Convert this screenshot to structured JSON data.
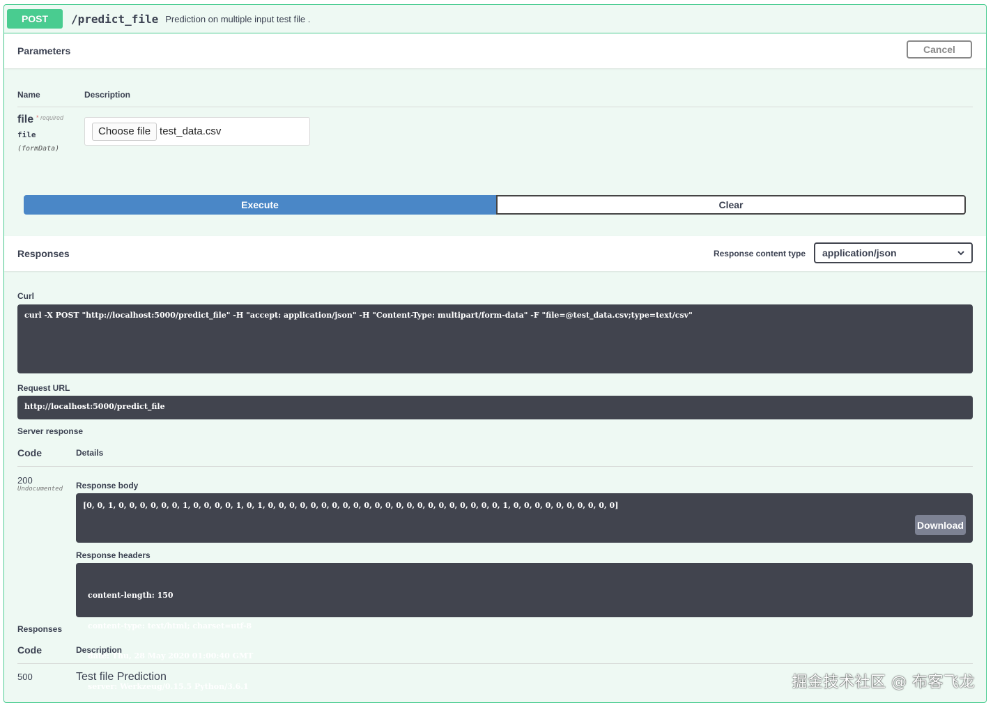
{
  "operation": {
    "method": "POST",
    "path": "/predict_file",
    "summary": "Prediction on multiple input test file ."
  },
  "parameters": {
    "title": "Parameters",
    "cancel_label": "Cancel",
    "col_name": "Name",
    "col_description": "Description",
    "param": {
      "name": "file",
      "required_marker": "*",
      "required_label": "required",
      "type": "file",
      "in": "(formData)",
      "choose_label": "Choose file",
      "file_value": "test_data.csv"
    },
    "execute_label": "Execute",
    "clear_label": "Clear"
  },
  "responses_header": {
    "title": "Responses",
    "content_type_label": "Response content type",
    "content_type_value": "application/json"
  },
  "live": {
    "curl_label": "Curl",
    "curl": "curl -X POST \"http://localhost:5000/predict_file\" -H \"accept: application/json\" -H \"Content-Type: multipart/form-data\" -F \"file=@test_data.csv;type=text/csv\"",
    "request_url_label": "Request URL",
    "request_url": "http://localhost:5000/predict_file",
    "server_response_label": "Server response",
    "code_header": "Code",
    "details_header": "Details",
    "code": "200",
    "code_note": "Undocumented",
    "body_label": "Response body",
    "body": "[0, 0, 1, 0, 0, 0, 0, 0, 0, 1, 0, 0, 0, 0, 1, 0, 1, 0, 0, 0, 0, 0, 0, 0, 0, 0, 0, 0, 0, 0, 0, 0, 0, 0, 0, 0, 0, 0, 0, 1, 0, 0, 0, 0, 0, 0, 0, 0, 0, 0]",
    "download_label": "Download",
    "headers_label": "Response headers",
    "headers": [
      "content-length: 150",
      "content-type: text/html; charset=utf-8",
      "date: Thu, 28 May 2020 01:00:40 GMT",
      "server: Werkzeug/0.15.5 Python/3.6.1"
    ]
  },
  "documented": {
    "title": "Responses",
    "code_header": "Code",
    "description_header": "Description",
    "rows": [
      {
        "code": "500",
        "description": "Test file Prediction"
      }
    ]
  },
  "watermark": "掘金技术社区 @ 布客飞龙",
  "colors": {
    "post": "#49cc90",
    "execute": "#4a87c7",
    "code_bg": "#41444e"
  }
}
